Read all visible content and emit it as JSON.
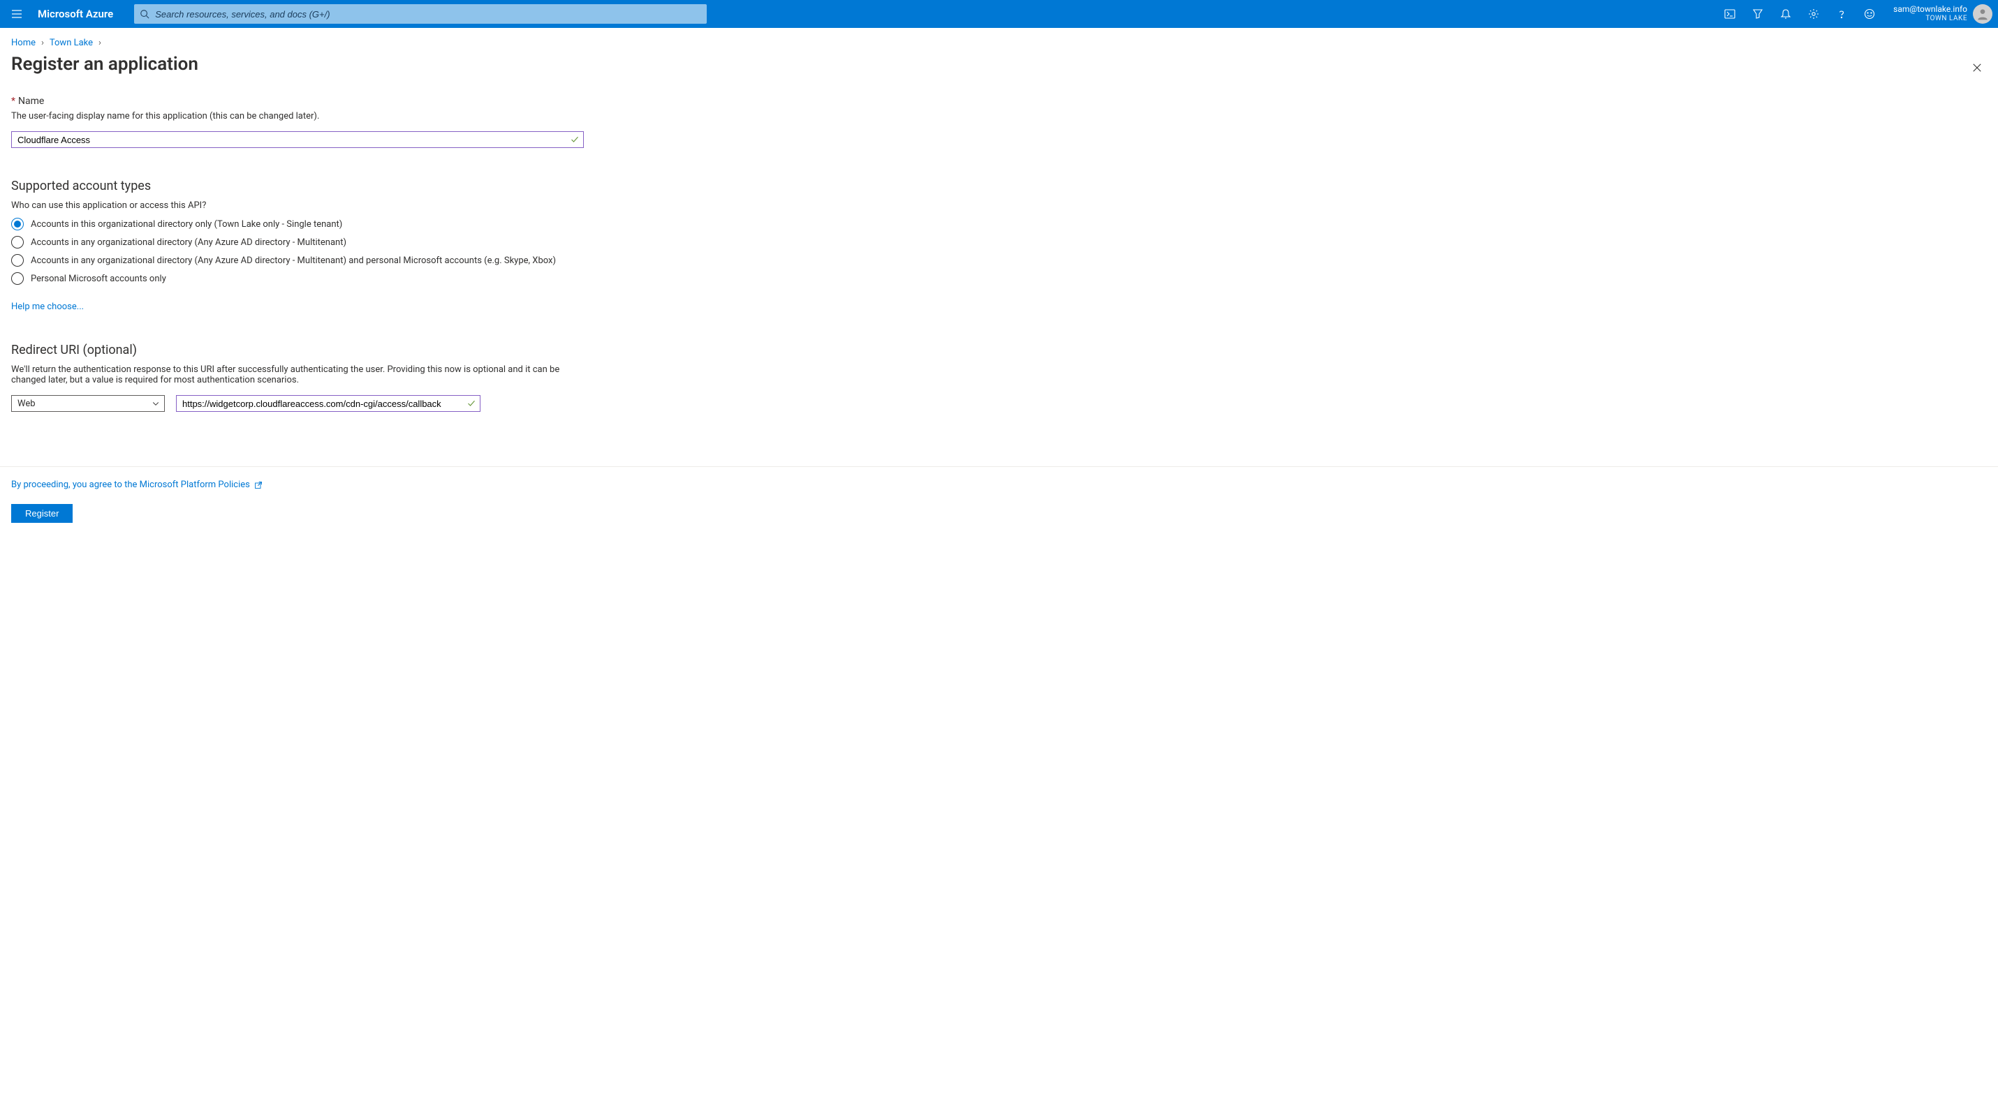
{
  "topbar": {
    "brand": "Microsoft Azure",
    "search_placeholder": "Search resources, services, and docs (G+/)"
  },
  "account": {
    "email": "sam@townlake.info",
    "tenant": "TOWN LAKE"
  },
  "breadcrumbs": {
    "home": "Home",
    "dir": "Town Lake"
  },
  "page": {
    "title": "Register an application"
  },
  "name_section": {
    "label": "Name",
    "helper": "The user-facing display name for this application (this can be changed later).",
    "value": "Cloudflare Access"
  },
  "account_types": {
    "heading": "Supported account types",
    "question": "Who can use this application or access this API?",
    "options": [
      "Accounts in this organizational directory only (Town Lake only - Single tenant)",
      "Accounts in any organizational directory (Any Azure AD directory - Multitenant)",
      "Accounts in any organizational directory (Any Azure AD directory - Multitenant) and personal Microsoft accounts (e.g. Skype, Xbox)",
      "Personal Microsoft accounts only"
    ],
    "selected_index": 0,
    "help_link": "Help me choose..."
  },
  "redirect": {
    "heading": "Redirect URI (optional)",
    "helper": "We'll return the authentication response to this URI after successfully authenticating the user. Providing this now is optional and it can be changed later, but a value is required for most authentication scenarios.",
    "platform": "Web",
    "uri": "https://widgetcorp.cloudflareaccess.com/cdn-cgi/access/callback"
  },
  "footer": {
    "policies": "By proceeding, you agree to the Microsoft Platform Policies",
    "register": "Register"
  }
}
